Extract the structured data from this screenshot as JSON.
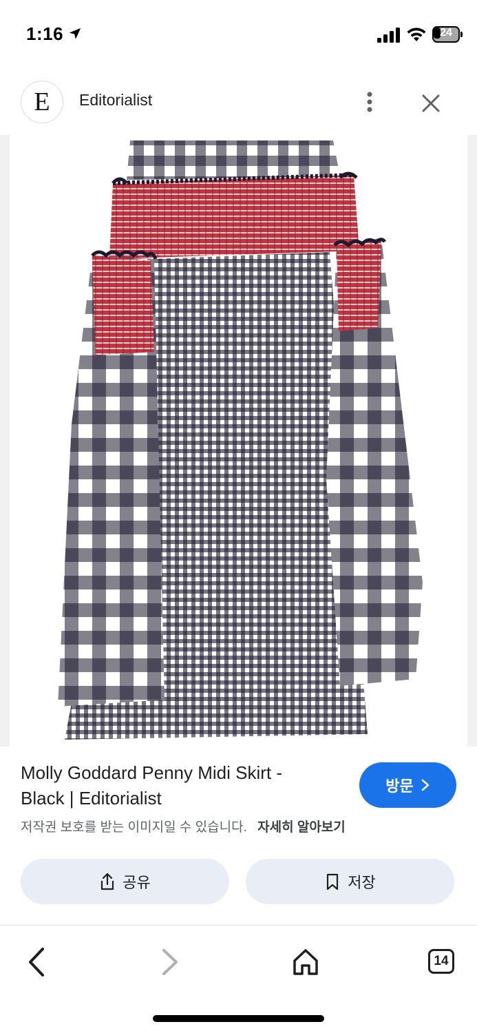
{
  "status_bar": {
    "time": "1:16",
    "battery": "24",
    "icons": [
      "location-arrow-icon",
      "cellular-signal-icon",
      "wifi-icon",
      "battery-icon"
    ]
  },
  "header": {
    "logo_letter": "E",
    "site_name": "Editorialist",
    "icons": [
      "more-vert-icon",
      "close-icon"
    ]
  },
  "image": {
    "alt": "Molly Goddard Penny Midi Skirt - Black"
  },
  "result": {
    "title": "Molly Goddard Penny Midi Skirt - Black | Editorialist",
    "visit_label": "방문",
    "copyright_notice": "저작권 보호를 받는 이미지일 수 있습니다.",
    "learn_more": "자세히 알아보기"
  },
  "actions": {
    "share_label": "공유",
    "save_label": "저장"
  },
  "bottom_nav": {
    "tab_count": "14",
    "icons": [
      "back-icon",
      "forward-icon",
      "home-icon",
      "tabs-icon"
    ]
  },
  "colors": {
    "accent": "#1a73e8",
    "chip_bg": "#e9eef6",
    "gingham_dark": "#1c1a2e",
    "smock_red": "#c23440"
  }
}
